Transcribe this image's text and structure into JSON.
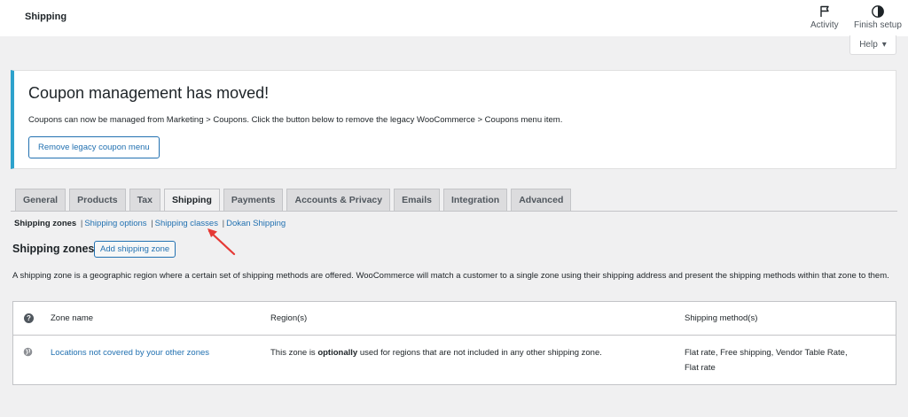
{
  "header": {
    "title": "Shipping",
    "activity_label": "Activity",
    "finish_setup_label": "Finish setup",
    "help_label": "Help"
  },
  "notice": {
    "title": "Coupon management has moved!",
    "text": "Coupons can now be managed from Marketing > Coupons. Click the button below to remove the legacy WooCommerce > Coupons menu item.",
    "button_label": "Remove legacy coupon menu"
  },
  "tabs": [
    {
      "label": "General"
    },
    {
      "label": "Products"
    },
    {
      "label": "Tax"
    },
    {
      "label": "Shipping",
      "active": true
    },
    {
      "label": "Payments"
    },
    {
      "label": "Accounts & Privacy"
    },
    {
      "label": "Emails"
    },
    {
      "label": "Integration"
    },
    {
      "label": "Advanced"
    }
  ],
  "subnav": {
    "active": "Shipping zones",
    "links": [
      "Shipping options",
      "Shipping classes",
      "Dokan Shipping"
    ]
  },
  "section": {
    "title": "Shipping zones",
    "add_button": "Add shipping zone",
    "description": "A shipping zone is a geographic region where a certain set of shipping methods are offered. WooCommerce will match a customer to a single zone using their shipping address and present the shipping methods within that zone to them."
  },
  "table": {
    "headers": {
      "help": "?",
      "zone_name": "Zone name",
      "regions": "Region(s)",
      "methods": "Shipping method(s)"
    },
    "row": {
      "zone_name": "Locations not covered by your other zones",
      "region_before": "This zone is ",
      "region_bold": "optionally",
      "region_after": " used for regions that are not included in any other shipping zone.",
      "methods_line1": "Flat rate, Free shipping, Vendor Table Rate,",
      "methods_line2": "Flat rate"
    }
  },
  "colors": {
    "accent": "#2271b1",
    "notice_border": "#2ea2cc",
    "annotation_arrow": "#e53935"
  }
}
